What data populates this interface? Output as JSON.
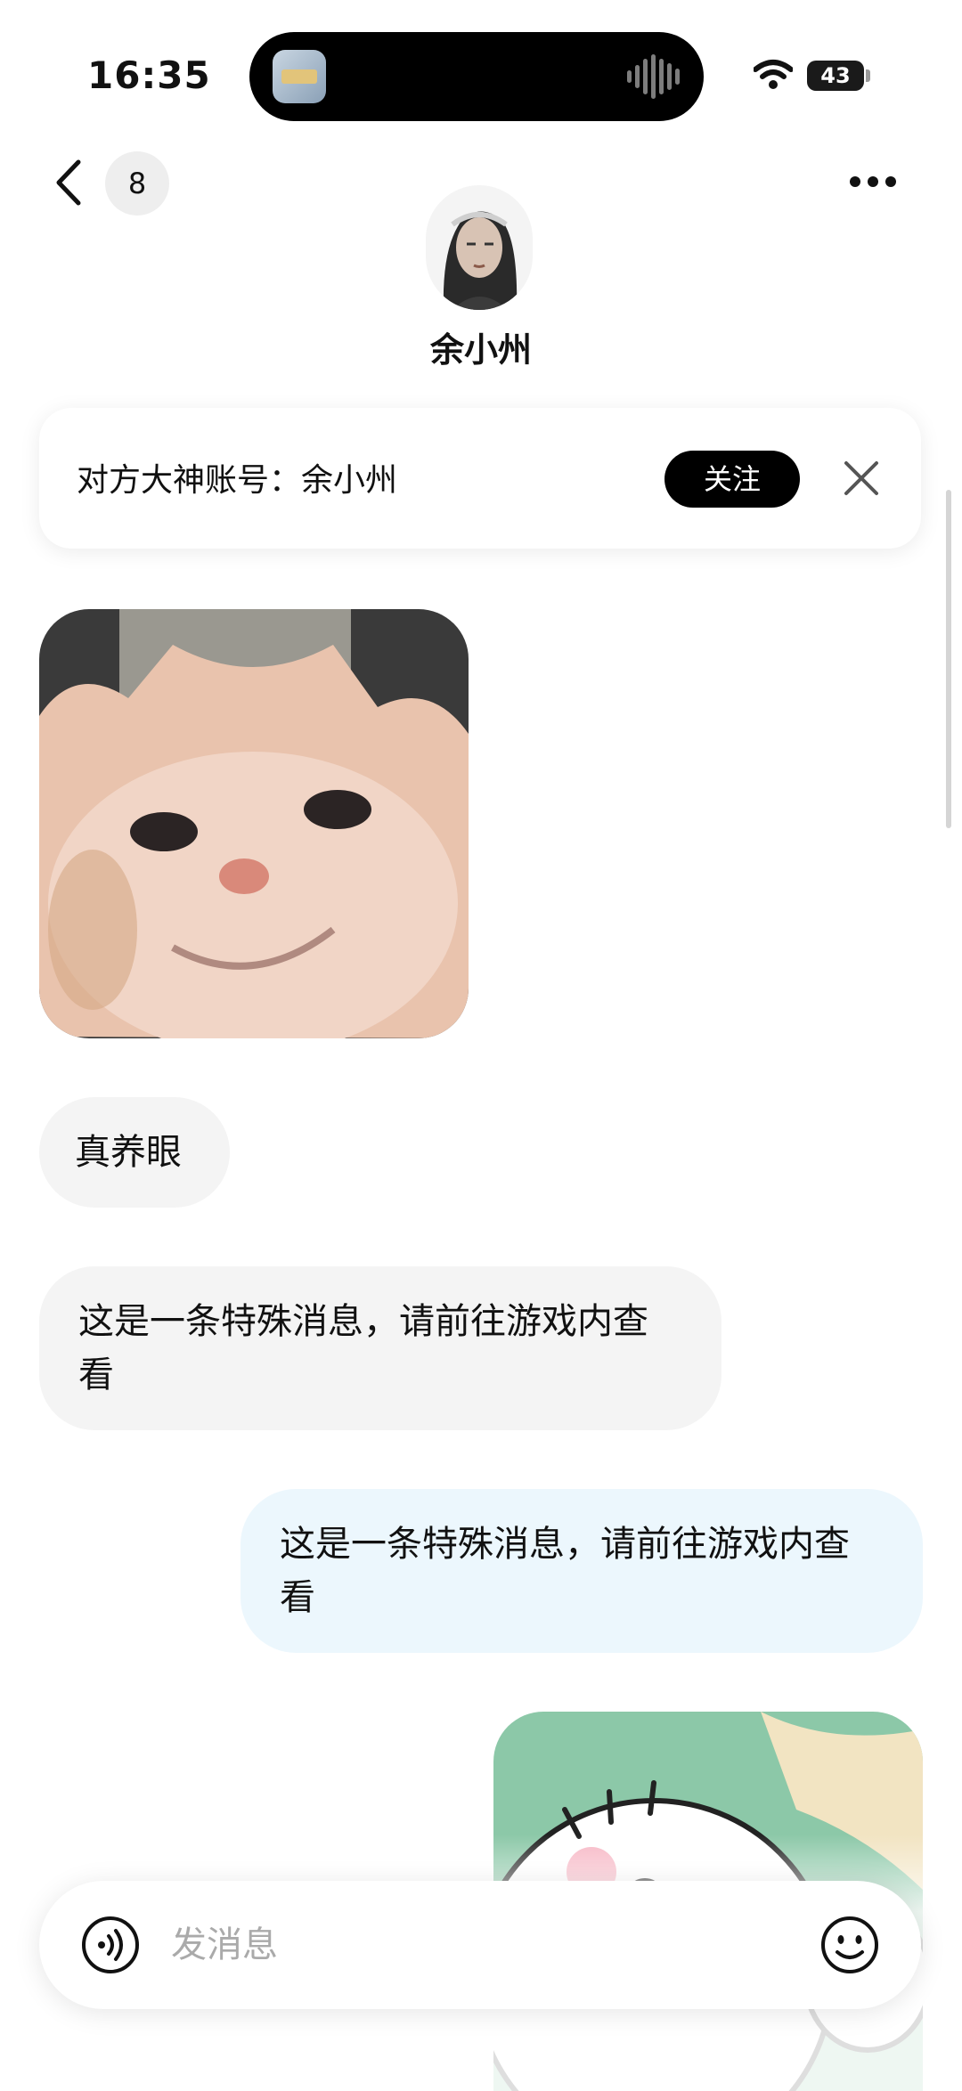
{
  "status_bar": {
    "time": "16:35",
    "battery": "43"
  },
  "header": {
    "unread_count": "8",
    "contact_name": "余小州"
  },
  "follow_card": {
    "text": "对方大神账号：余小州",
    "follow_label": "关注"
  },
  "messages": [
    {
      "from": "other",
      "type": "image",
      "content": "cat-sticker"
    },
    {
      "from": "other",
      "type": "text",
      "text": "真养眼"
    },
    {
      "from": "other",
      "type": "text",
      "text": "这是一条特殊消息，请前往游戏内查看"
    },
    {
      "from": "me",
      "type": "text",
      "text": "这是一条特殊消息，请前往游戏内查看"
    },
    {
      "from": "me",
      "type": "image",
      "content": "cartoon-sticker"
    }
  ],
  "input": {
    "placeholder": "发消息"
  },
  "colors": {
    "incoming_bubble": "#f4f4f4",
    "outgoing_bubble": "#ecf7fd",
    "follow_button": "#000000"
  },
  "icons": [
    "back-icon",
    "more-icon",
    "close-icon",
    "voice-icon",
    "emoji-icon",
    "wifi-icon"
  ]
}
